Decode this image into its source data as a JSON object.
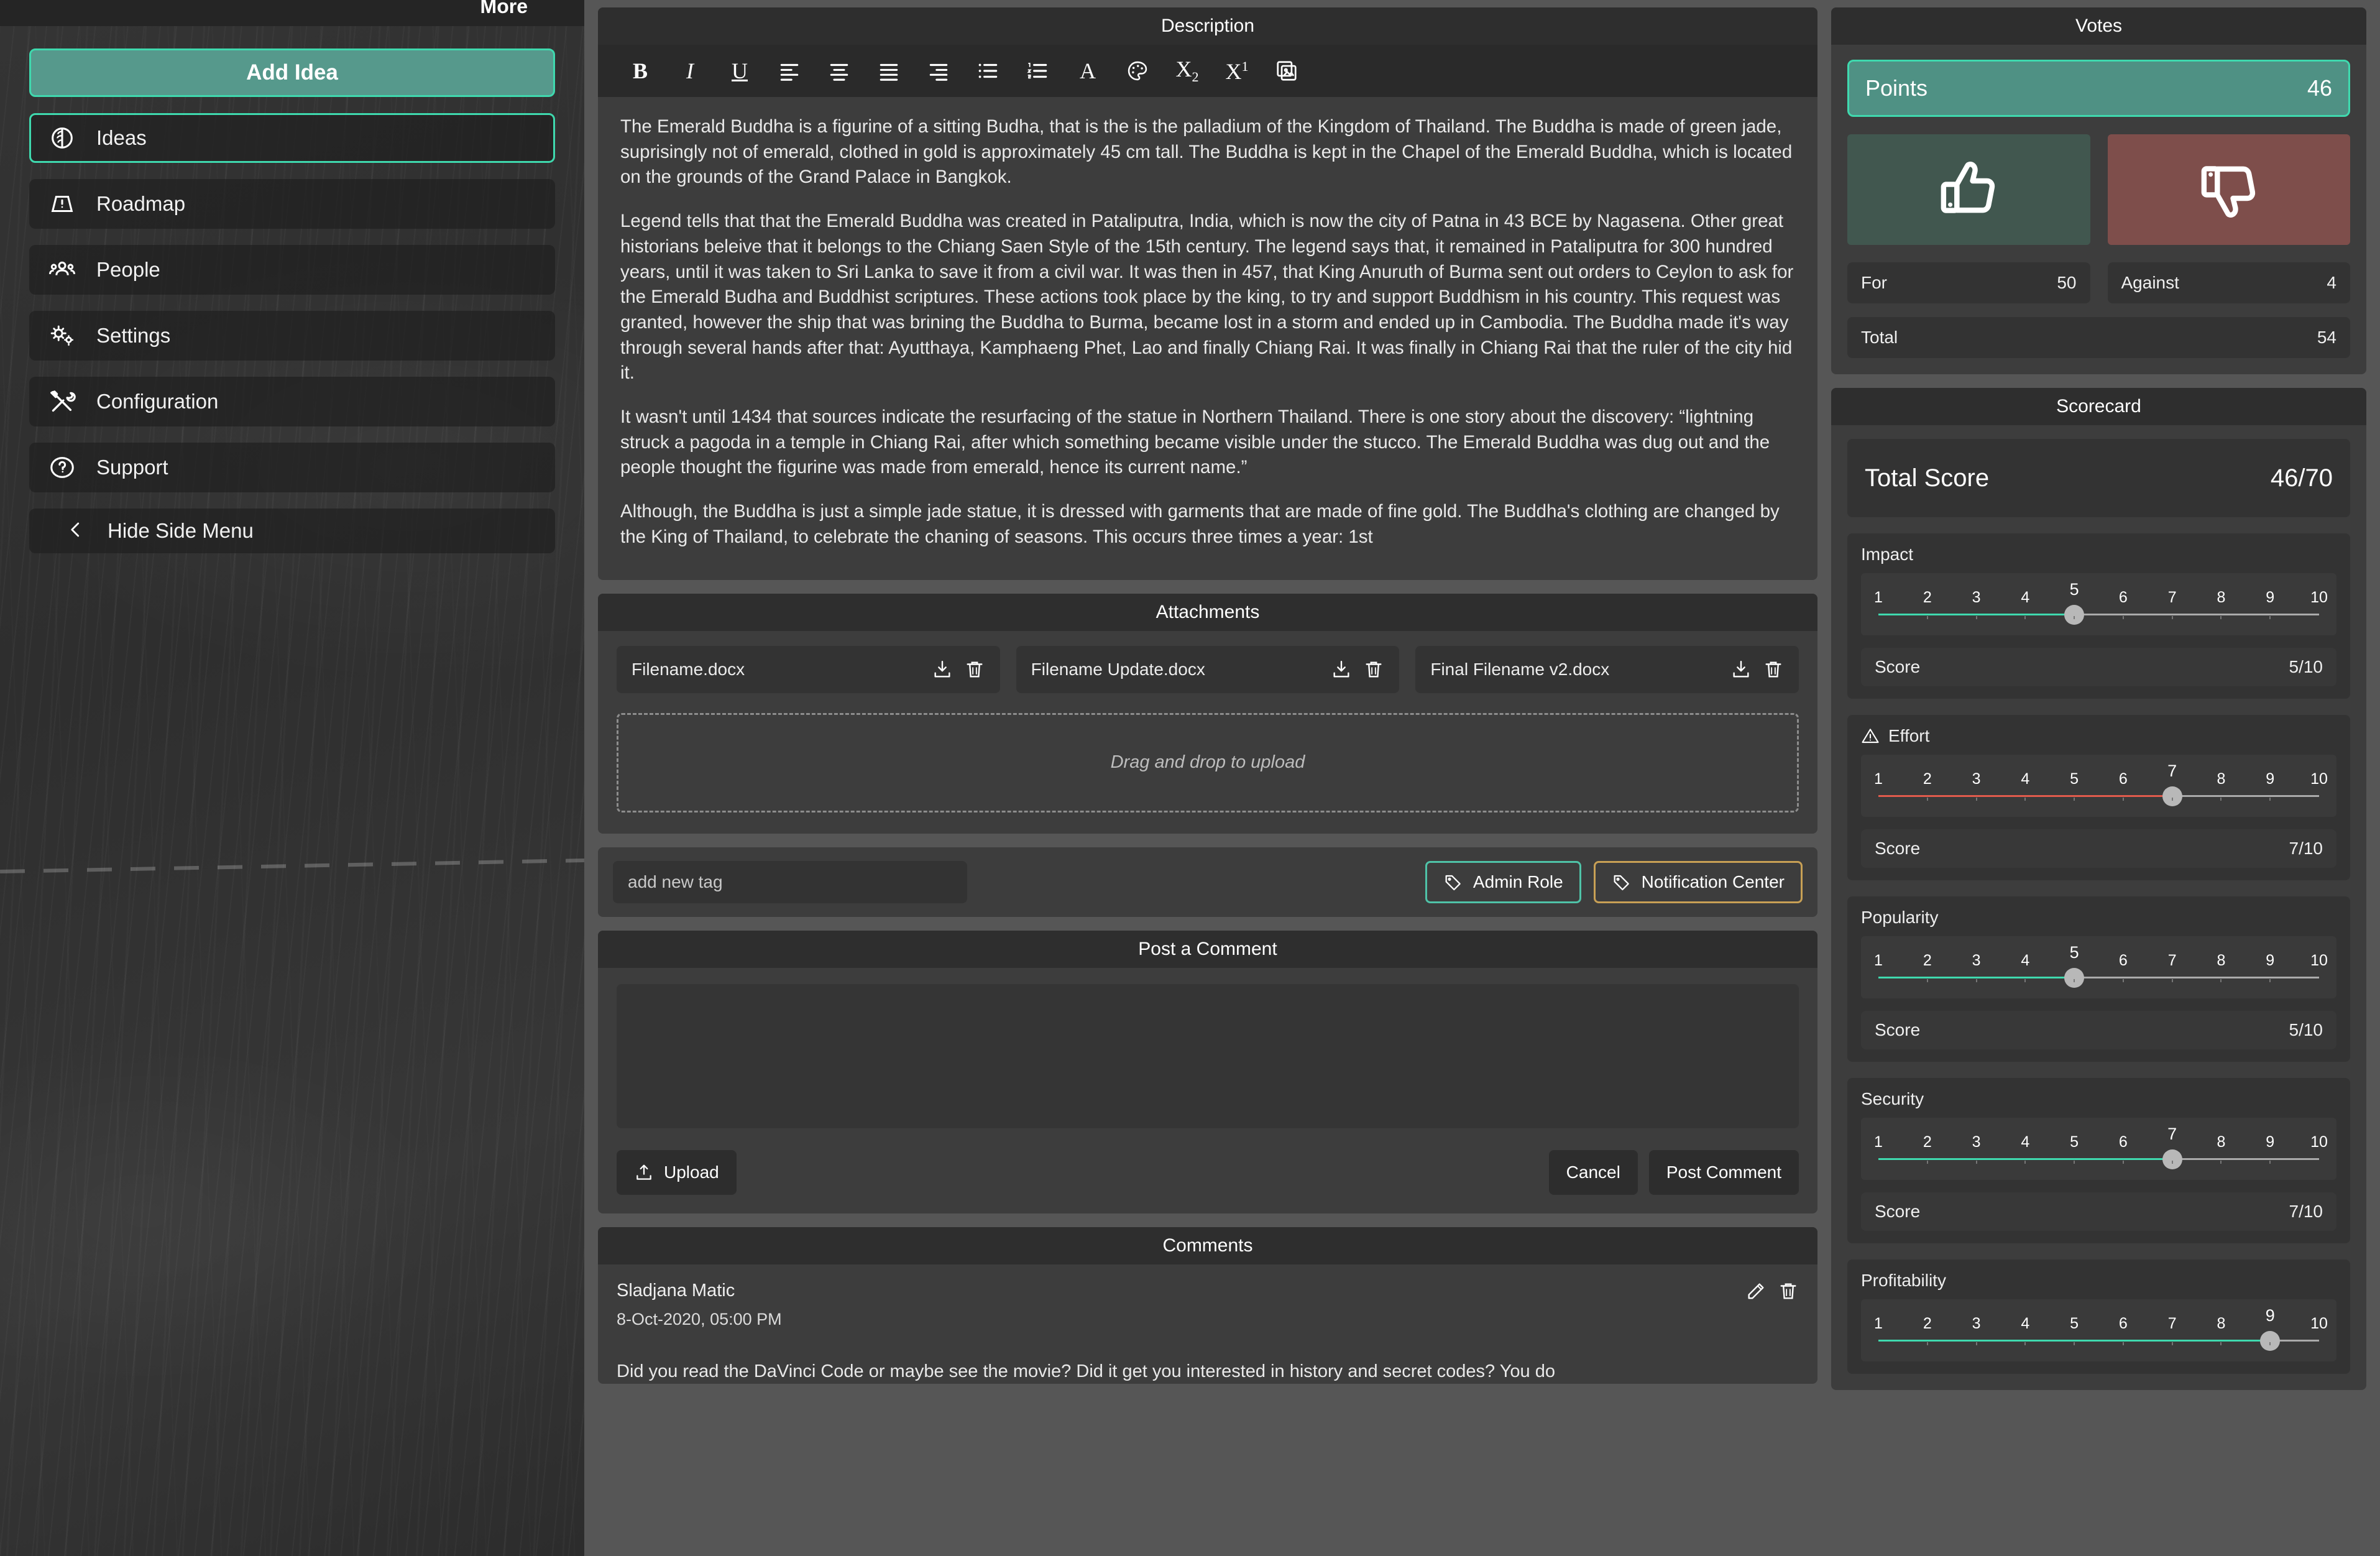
{
  "sidebar": {
    "more_label": "More",
    "add_idea_label": "Add Idea",
    "items": [
      {
        "label": "Ideas",
        "icon": "brain-icon",
        "active": true
      },
      {
        "label": "Roadmap",
        "icon": "roadmap-icon",
        "active": false
      },
      {
        "label": "People",
        "icon": "people-icon",
        "active": false
      },
      {
        "label": "Settings",
        "icon": "gears-icon",
        "active": false
      },
      {
        "label": "Configuration",
        "icon": "tools-icon",
        "active": false
      },
      {
        "label": "Support",
        "icon": "question-icon",
        "active": false
      }
    ],
    "hide_menu_label": "Hide Side Menu"
  },
  "description": {
    "title": "Description",
    "toolbar": [
      {
        "name": "bold-icon",
        "glyph": "B"
      },
      {
        "name": "italic-icon",
        "glyph": "I"
      },
      {
        "name": "underline-icon",
        "glyph": "U"
      },
      {
        "name": "align-left-icon",
        "glyph": ""
      },
      {
        "name": "align-center-icon",
        "glyph": ""
      },
      {
        "name": "align-justify-icon",
        "glyph": ""
      },
      {
        "name": "align-right-icon",
        "glyph": ""
      },
      {
        "name": "bulleted-list-icon",
        "glyph": ""
      },
      {
        "name": "numbered-list-icon",
        "glyph": ""
      },
      {
        "name": "font-color-icon",
        "glyph": "A"
      },
      {
        "name": "palette-icon",
        "glyph": ""
      },
      {
        "name": "subscript-icon",
        "glyph": ""
      },
      {
        "name": "superscript-icon",
        "glyph": ""
      },
      {
        "name": "insert-image-icon",
        "glyph": ""
      }
    ],
    "paragraphs": [
      "The Emerald Buddha is a figurine of a sitting Budha, that is the is the palladium of the Kingdom of Thailand. The Buddha is made of green jade, suprisingly not of emerald, clothed in gold is approximately 45 cm tall. The Buddha is kept in the Chapel of the Emerald Buddha, which is located on the grounds of the Grand Palace in Bangkok.",
      "Legend tells that that the Emerald Buddha was created in Pataliputra, India, which is now the city of Patna in 43 BCE by Nagasena. Other great historians beleive that it belongs to the Chiang Saen Style of the 15th century. The legend says that, it remained in Pataliputra for 300 hundred years, until it was taken to Sri Lanka to save it from a civil war. It was then in 457, that King Anuruth of Burma sent out orders to Ceylon to ask for the Emerald Budha and Buddhist scriptures. These actions took place by the king, to try and support Buddhism in his country. This request was granted, however the ship that was brining the Buddha to Burma, became lost in a storm and ended up in Cambodia. The Buddha made it's way through several hands after that: Ayutthaya, Kamphaeng Phet, Lao and finally Chiang Rai. It was finally in Chiang Rai that the ruler of the city hid it.",
      "It wasn't until 1434 that sources indicate the resurfacing of the statue in Northern Thailand. There is one story about the discovery: “lightning struck a pagoda in a temple in Chiang Rai, after which something became visible under the stucco. The Emerald Buddha was dug out and the people thought the figurine was made from emerald, hence its current name.”",
      "Although, the Buddha is just a simple jade statue, it is dressed with garments that are made of fine gold. The Buddha's clothing are changed by the King of Thailand, to celebrate the chaning of seasons. This occurs three times a year: 1st"
    ]
  },
  "attachments": {
    "title": "Attachments",
    "files": [
      {
        "name": "Filename.docx"
      },
      {
        "name": "Filename Update.docx"
      },
      {
        "name": "Final Filename v2.docx"
      }
    ],
    "dropzone_label": "Drag and drop to upload"
  },
  "tags": {
    "input_placeholder": "add new tag",
    "pills": [
      {
        "label": "Admin Role",
        "color": "#4fc3a8"
      },
      {
        "label": "Notification Center",
        "color": "#c8a055"
      }
    ]
  },
  "post_comment": {
    "title": "Post a Comment",
    "textarea_value": "",
    "textarea_placeholder": "",
    "upload_label": "Upload",
    "cancel_label": "Cancel",
    "post_label": "Post Comment"
  },
  "comments": {
    "title": "Comments",
    "items": [
      {
        "author": "Sladjana Matic",
        "date": "8-Oct-2020, 05:00 PM",
        "text": "Did you read the DaVinci Code or maybe see the movie? Did it get you interested in history and secret codes? You do"
      }
    ]
  },
  "votes": {
    "title": "Votes",
    "points_label": "Points",
    "points_value": "46",
    "thumbs_up_icon": "thumbs-up-icon",
    "thumbs_down_icon": "thumbs-down-icon",
    "for_label": "For",
    "for_value": "50",
    "against_label": "Against",
    "against_value": "4",
    "total_label": "Total",
    "total_value": "54"
  },
  "scorecard": {
    "title": "Scorecard",
    "total_score_label": "Total Score",
    "total_score_value": "46/70",
    "score_label": "Score",
    "criteria": [
      {
        "name": "Impact",
        "value": 5,
        "min": 1,
        "max": 10,
        "score": "5/10",
        "fill_color": "#3fd9ae",
        "warning": false
      },
      {
        "name": "Effort",
        "value": 7,
        "min": 1,
        "max": 10,
        "score": "7/10",
        "fill_color": "#e15b4c",
        "warning": true
      },
      {
        "name": "Popularity",
        "value": 5,
        "min": 1,
        "max": 10,
        "score": "5/10",
        "fill_color": "#3fd9ae",
        "warning": false
      },
      {
        "name": "Security",
        "value": 7,
        "min": 1,
        "max": 10,
        "score": "7/10",
        "fill_color": "#3fd9ae",
        "warning": false
      },
      {
        "name": "Profitability",
        "value": 9,
        "min": 1,
        "max": 10,
        "score": "",
        "fill_color": "#3fd9ae",
        "warning": false
      }
    ]
  },
  "theme": {
    "accent_green": "#3fd9ae",
    "accent_gold": "#c8a055",
    "danger_red": "#e15b4c",
    "panel_bg": "#3d3d3d",
    "page_bg": "#565656"
  }
}
